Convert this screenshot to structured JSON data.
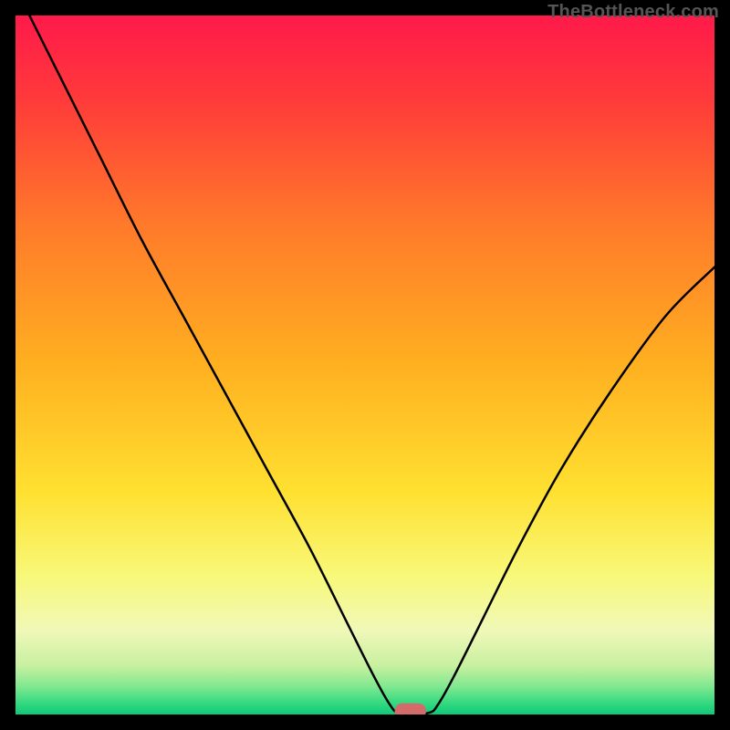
{
  "watermark": "TheBottleneck.com",
  "chart_data": {
    "type": "line",
    "title": "",
    "xlabel": "",
    "ylabel": "",
    "xlim": [
      0,
      100
    ],
    "ylim": [
      0,
      100
    ],
    "grid": false,
    "legend": false,
    "background_gradient": {
      "stops": [
        {
          "offset": 0.0,
          "color": "#ff1a4a"
        },
        {
          "offset": 0.12,
          "color": "#ff3a3a"
        },
        {
          "offset": 0.3,
          "color": "#ff7a2a"
        },
        {
          "offset": 0.5,
          "color": "#ffb020"
        },
        {
          "offset": 0.68,
          "color": "#ffe030"
        },
        {
          "offset": 0.8,
          "color": "#f8f878"
        },
        {
          "offset": 0.88,
          "color": "#f0f8b8"
        },
        {
          "offset": 0.93,
          "color": "#c8f0a0"
        },
        {
          "offset": 0.96,
          "color": "#80e890"
        },
        {
          "offset": 0.985,
          "color": "#30d880"
        },
        {
          "offset": 1.0,
          "color": "#10c878"
        }
      ]
    },
    "series": [
      {
        "name": "bottleneck-curve",
        "type": "line",
        "stroke": "#000000",
        "stroke_width": 2.5,
        "points": [
          {
            "x": 2.0,
            "y": 100.0
          },
          {
            "x": 6.0,
            "y": 92.0
          },
          {
            "x": 12.0,
            "y": 80.0
          },
          {
            "x": 18.0,
            "y": 68.0
          },
          {
            "x": 24.0,
            "y": 57.0
          },
          {
            "x": 30.0,
            "y": 46.0
          },
          {
            "x": 36.0,
            "y": 35.0
          },
          {
            "x": 42.0,
            "y": 24.0
          },
          {
            "x": 47.0,
            "y": 14.0
          },
          {
            "x": 51.0,
            "y": 6.0
          },
          {
            "x": 53.5,
            "y": 1.5
          },
          {
            "x": 55.0,
            "y": 0.2
          },
          {
            "x": 59.0,
            "y": 0.2
          },
          {
            "x": 60.5,
            "y": 1.5
          },
          {
            "x": 63.0,
            "y": 6.0
          },
          {
            "x": 67.0,
            "y": 14.0
          },
          {
            "x": 72.0,
            "y": 24.0
          },
          {
            "x": 78.0,
            "y": 35.0
          },
          {
            "x": 85.0,
            "y": 46.0
          },
          {
            "x": 93.0,
            "y": 57.0
          },
          {
            "x": 100.0,
            "y": 64.0
          }
        ]
      }
    ],
    "marker": {
      "name": "target-marker",
      "shape": "rounded-rect",
      "fill": "#d56a6a",
      "cx": 56.5,
      "cy": 0.5,
      "width": 4.5,
      "height": 2.2,
      "rx": 1.1
    }
  }
}
